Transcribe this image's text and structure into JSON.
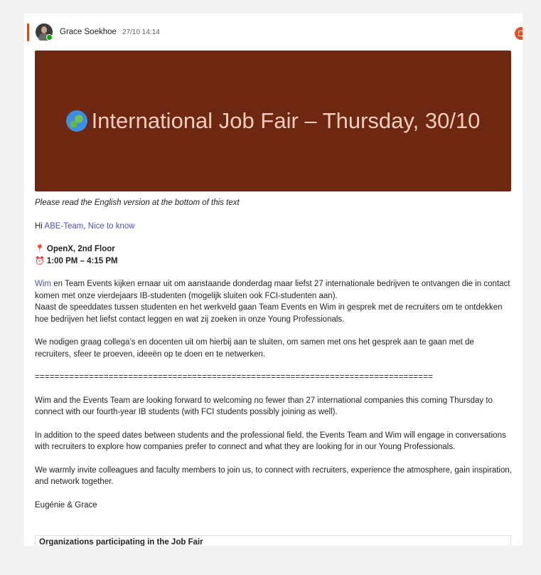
{
  "post": {
    "author": "Grace Soekhoe",
    "timestamp": "27/10 14:14",
    "banner_title": "International Job Fair – Thursday, 30/10",
    "banner_icon": "globe-icon",
    "colors": {
      "banner_bg": "#6e2711",
      "banner_text": "#f4cdbd",
      "accent": "#c4501c",
      "link": "#4f52b2",
      "presence": "#13a10e"
    }
  },
  "body": {
    "intro_italic": "Please read the English version at the bottom of this text",
    "greeting_prefix": "Hi ",
    "mention_team": "ABE-Team",
    "greeting_sep": ", ",
    "mention_nice": "Nice to know",
    "location": "OpenX, 2nd Floor",
    "time": "1:00 PM – 4:15 PM",
    "nl_p1_mention": "Wim",
    "nl_p1_rest": " en Team Events kijken ernaar uit om aanstaande donderdag maar liefst 27 internationale bedrijven te ontvangen die in contact komen met onze vierdejaars IB-studenten (mogelijk sluiten ook FCI-studenten aan).",
    "nl_p1_line2": "Naast de speeddates tussen studenten en het werkveld gaan Team Events en Wim in gesprek met de recruiters om te ontdekken hoe bedrijven het liefst contact leggen en wat zij zoeken in onze Young Professionals.",
    "nl_p2": "We nodigen graag collega’s en docenten uit om hierbij aan te sluiten, om samen met ons het gesprek aan te gaan met de recruiters, sfeer te proeven, ideeën op te doen en te netwerken.",
    "divider": "=================================================================================",
    "en_p1": "Wim and the Events Team are looking forward to welcoming no fewer than 27 international companies this coming Thursday to connect with our fourth-year IB students (with FCI students possibly joining as well).",
    "en_p2": "In addition to the speed dates between students and the professional field, the Events Team and Wim will engage in conversations with recruiters to explore how companies prefer to connect and what they are looking for in our Young Professionals.",
    "en_p3": "We warmly invite colleagues and faculty members to join us, to connect with recruiters, experience the atmosphere, gain inspiration, and network together.",
    "signature": "Eugénie & Grace",
    "table_header": "Organizations participating in the Job Fair"
  }
}
